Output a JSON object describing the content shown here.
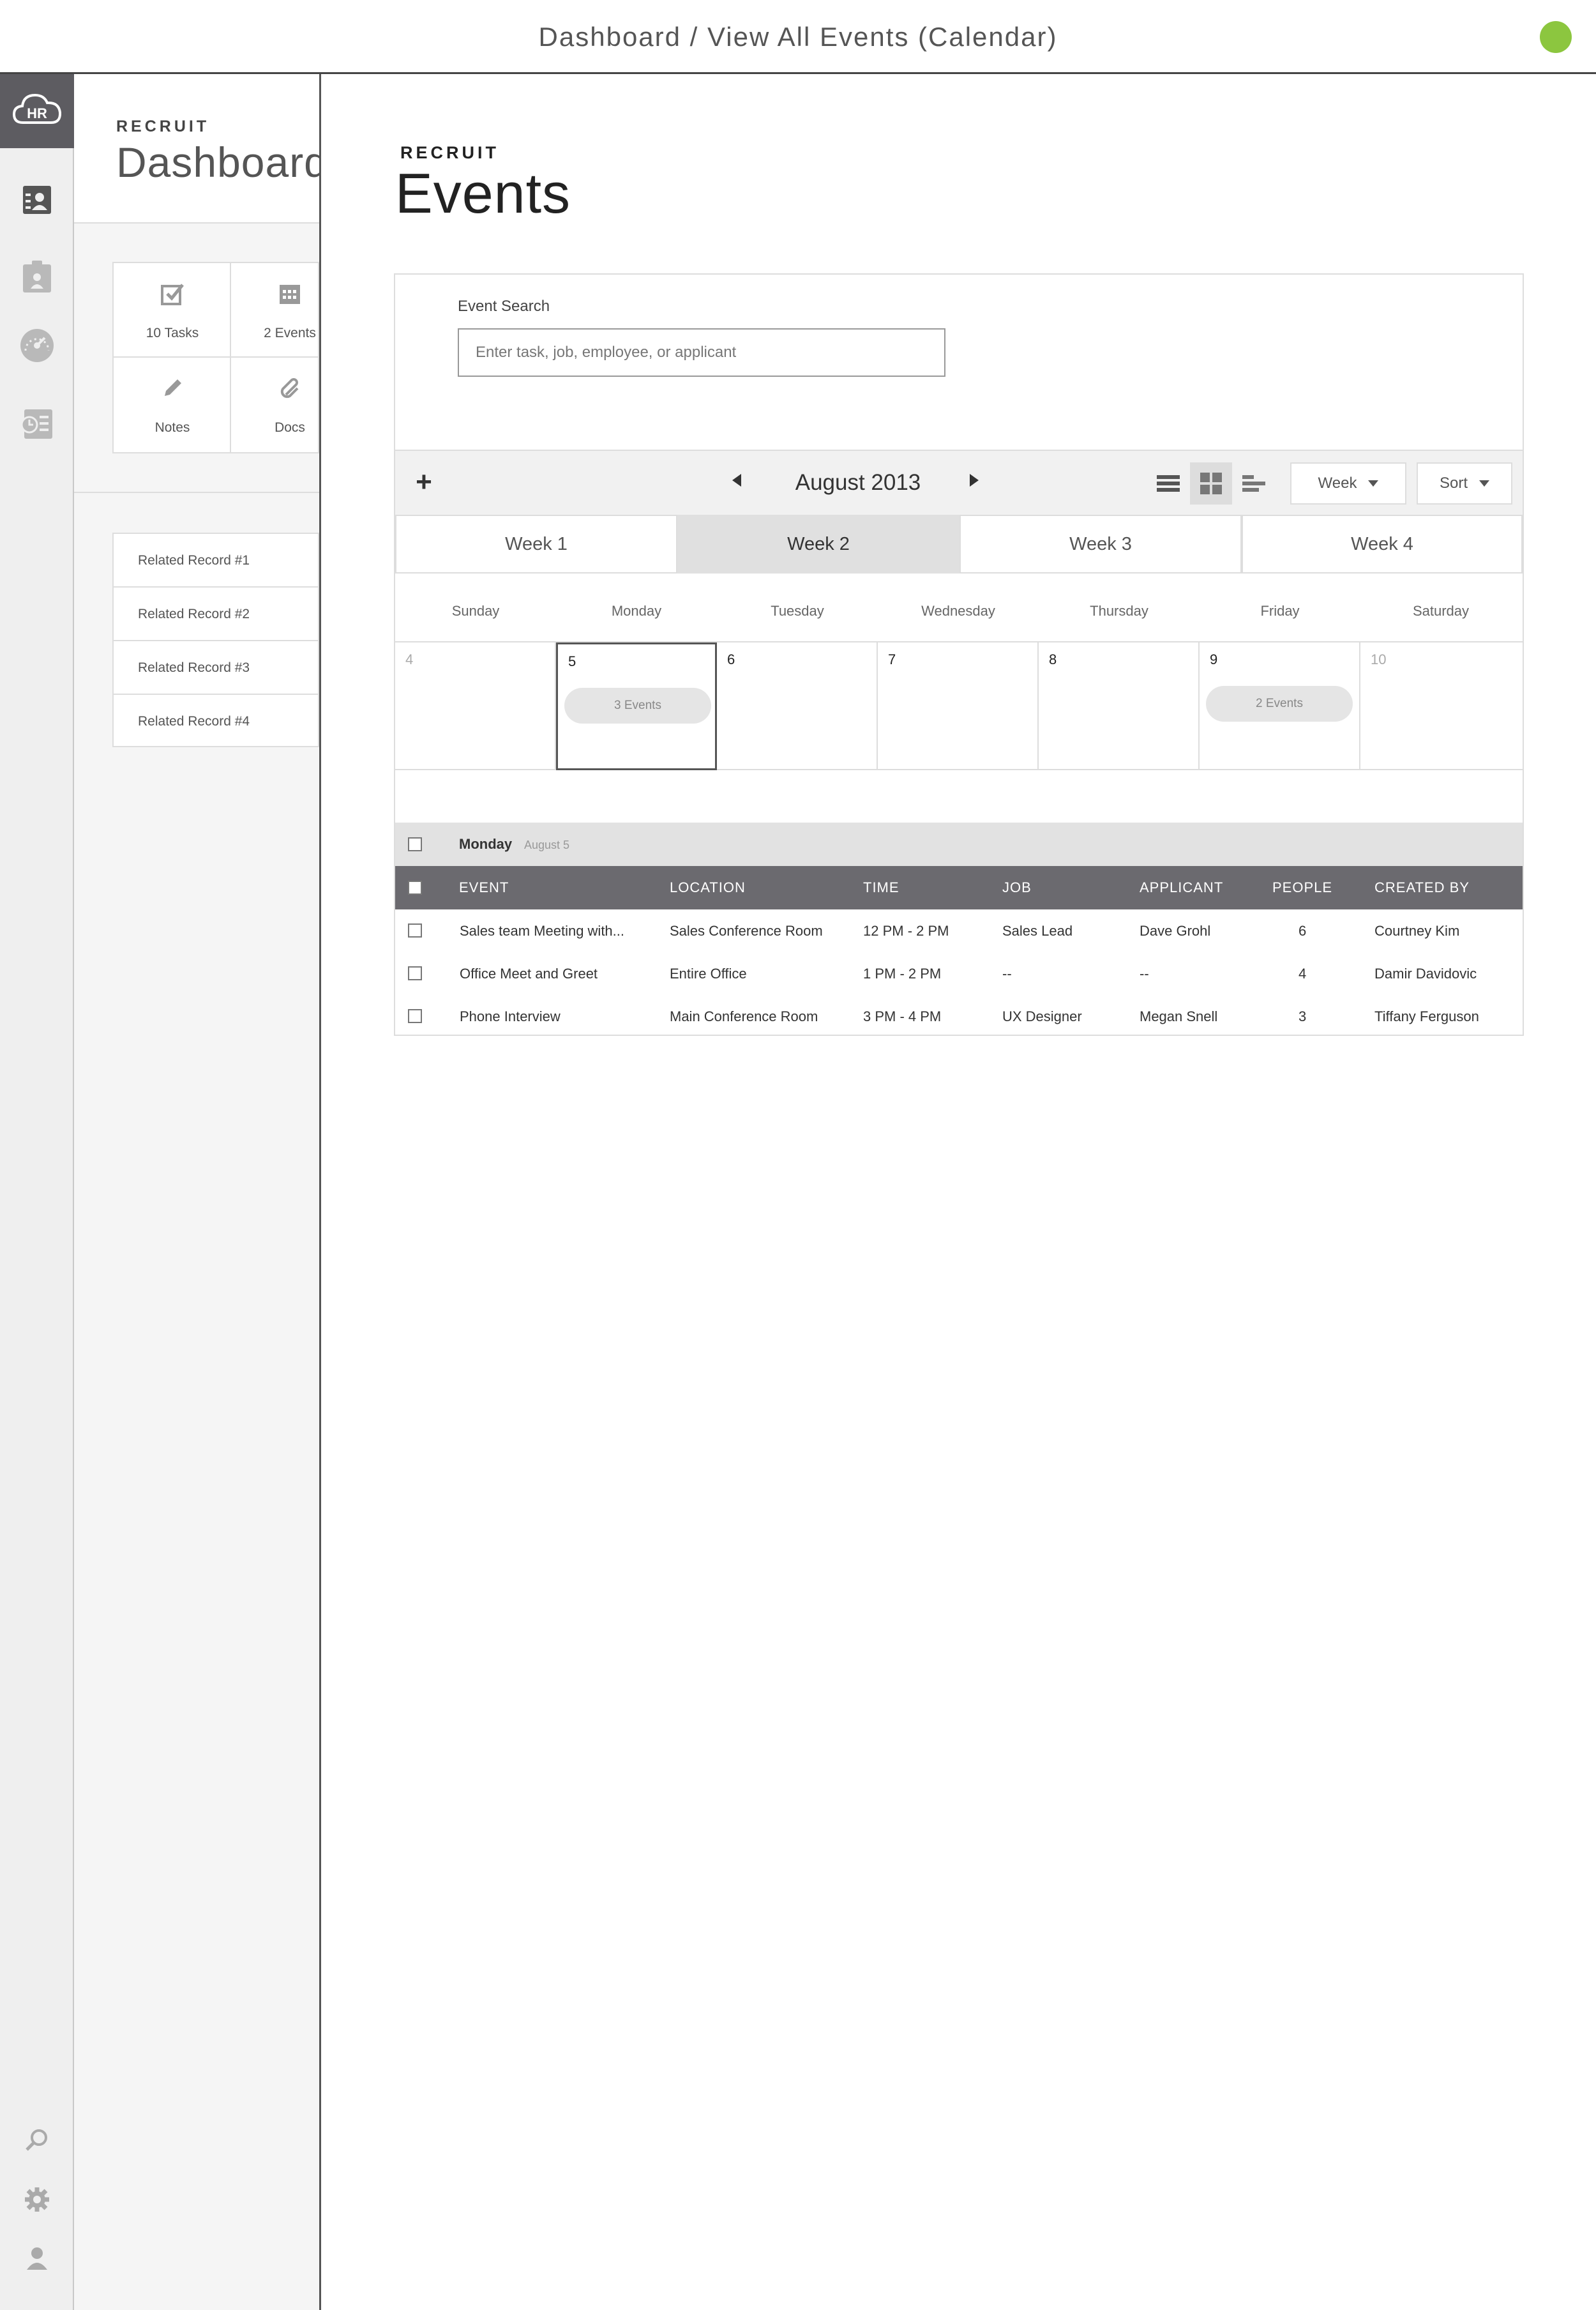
{
  "topbar": {
    "title": "Dashboard / View All Events (Calendar)",
    "status_color": "#8cc63f"
  },
  "rail": {
    "logo_text": "HR",
    "icons": [
      "contacts-icon",
      "clipboard-icon",
      "gauge-icon",
      "reports-icon",
      "search-icon",
      "gear-icon",
      "user-icon"
    ]
  },
  "dashboard": {
    "eyebrow": "RECRUIT",
    "title": "Dashboard",
    "tiles": [
      {
        "label": "10 Tasks",
        "icon": "checkbox-icon"
      },
      {
        "label": "2 Events",
        "icon": "calendar-icon"
      },
      {
        "label": "Notes",
        "icon": "pencil-icon"
      },
      {
        "label": "Docs",
        "icon": "paperclip-icon"
      }
    ],
    "related": [
      "Related Record #1",
      "Related Record #2",
      "Related Record #3",
      "Related Record #4"
    ]
  },
  "events": {
    "eyebrow": "RECRUIT",
    "title": "Events",
    "search": {
      "label": "Event Search",
      "placeholder": "Enter task, job, employee, or applicant",
      "value": ""
    },
    "toolbar": {
      "add": "+",
      "month": "August 2013",
      "view_dropdown": "Week",
      "sort_dropdown": "Sort",
      "active_view": "grid"
    },
    "weeks": [
      "Week 1",
      "Week 2",
      "Week 3",
      "Week 4"
    ],
    "active_week": "Week 2",
    "weekdays": [
      "Sunday",
      "Monday",
      "Tuesday",
      "Wednesday",
      "Thursday",
      "Friday",
      "Saturday"
    ],
    "days": [
      {
        "num": "4",
        "muted": true,
        "pill": ""
      },
      {
        "num": "5",
        "muted": false,
        "selected": true,
        "pill": "3 Events"
      },
      {
        "num": "6",
        "muted": false,
        "pill": ""
      },
      {
        "num": "7",
        "muted": false,
        "pill": ""
      },
      {
        "num": "8",
        "muted": false,
        "pill": ""
      },
      {
        "num": "9",
        "muted": false,
        "pill": "2 Events"
      },
      {
        "num": "10",
        "muted": true,
        "pill": ""
      }
    ],
    "day_group": {
      "name": "Monday",
      "date": "August 5"
    },
    "columns": [
      "EVENT",
      "LOCATION",
      "TIME",
      "JOB",
      "APPLICANT",
      "PEOPLE",
      "CREATED BY"
    ],
    "rows": [
      [
        "Sales team Meeting with...",
        "Sales Conference Room",
        "12 PM - 2 PM",
        "Sales Lead",
        "Dave Grohl",
        "6",
        "Courtney Kim"
      ],
      [
        "Office Meet and Greet",
        "Entire Office",
        "1  PM - 2 PM",
        "--",
        "--",
        "4",
        "Damir Davidovic"
      ],
      [
        "Phone Interview",
        "Main Conference Room",
        "3 PM - 4 PM",
        "UX Designer",
        "Megan Snell",
        "3",
        "Tiffany Ferguson"
      ]
    ]
  }
}
